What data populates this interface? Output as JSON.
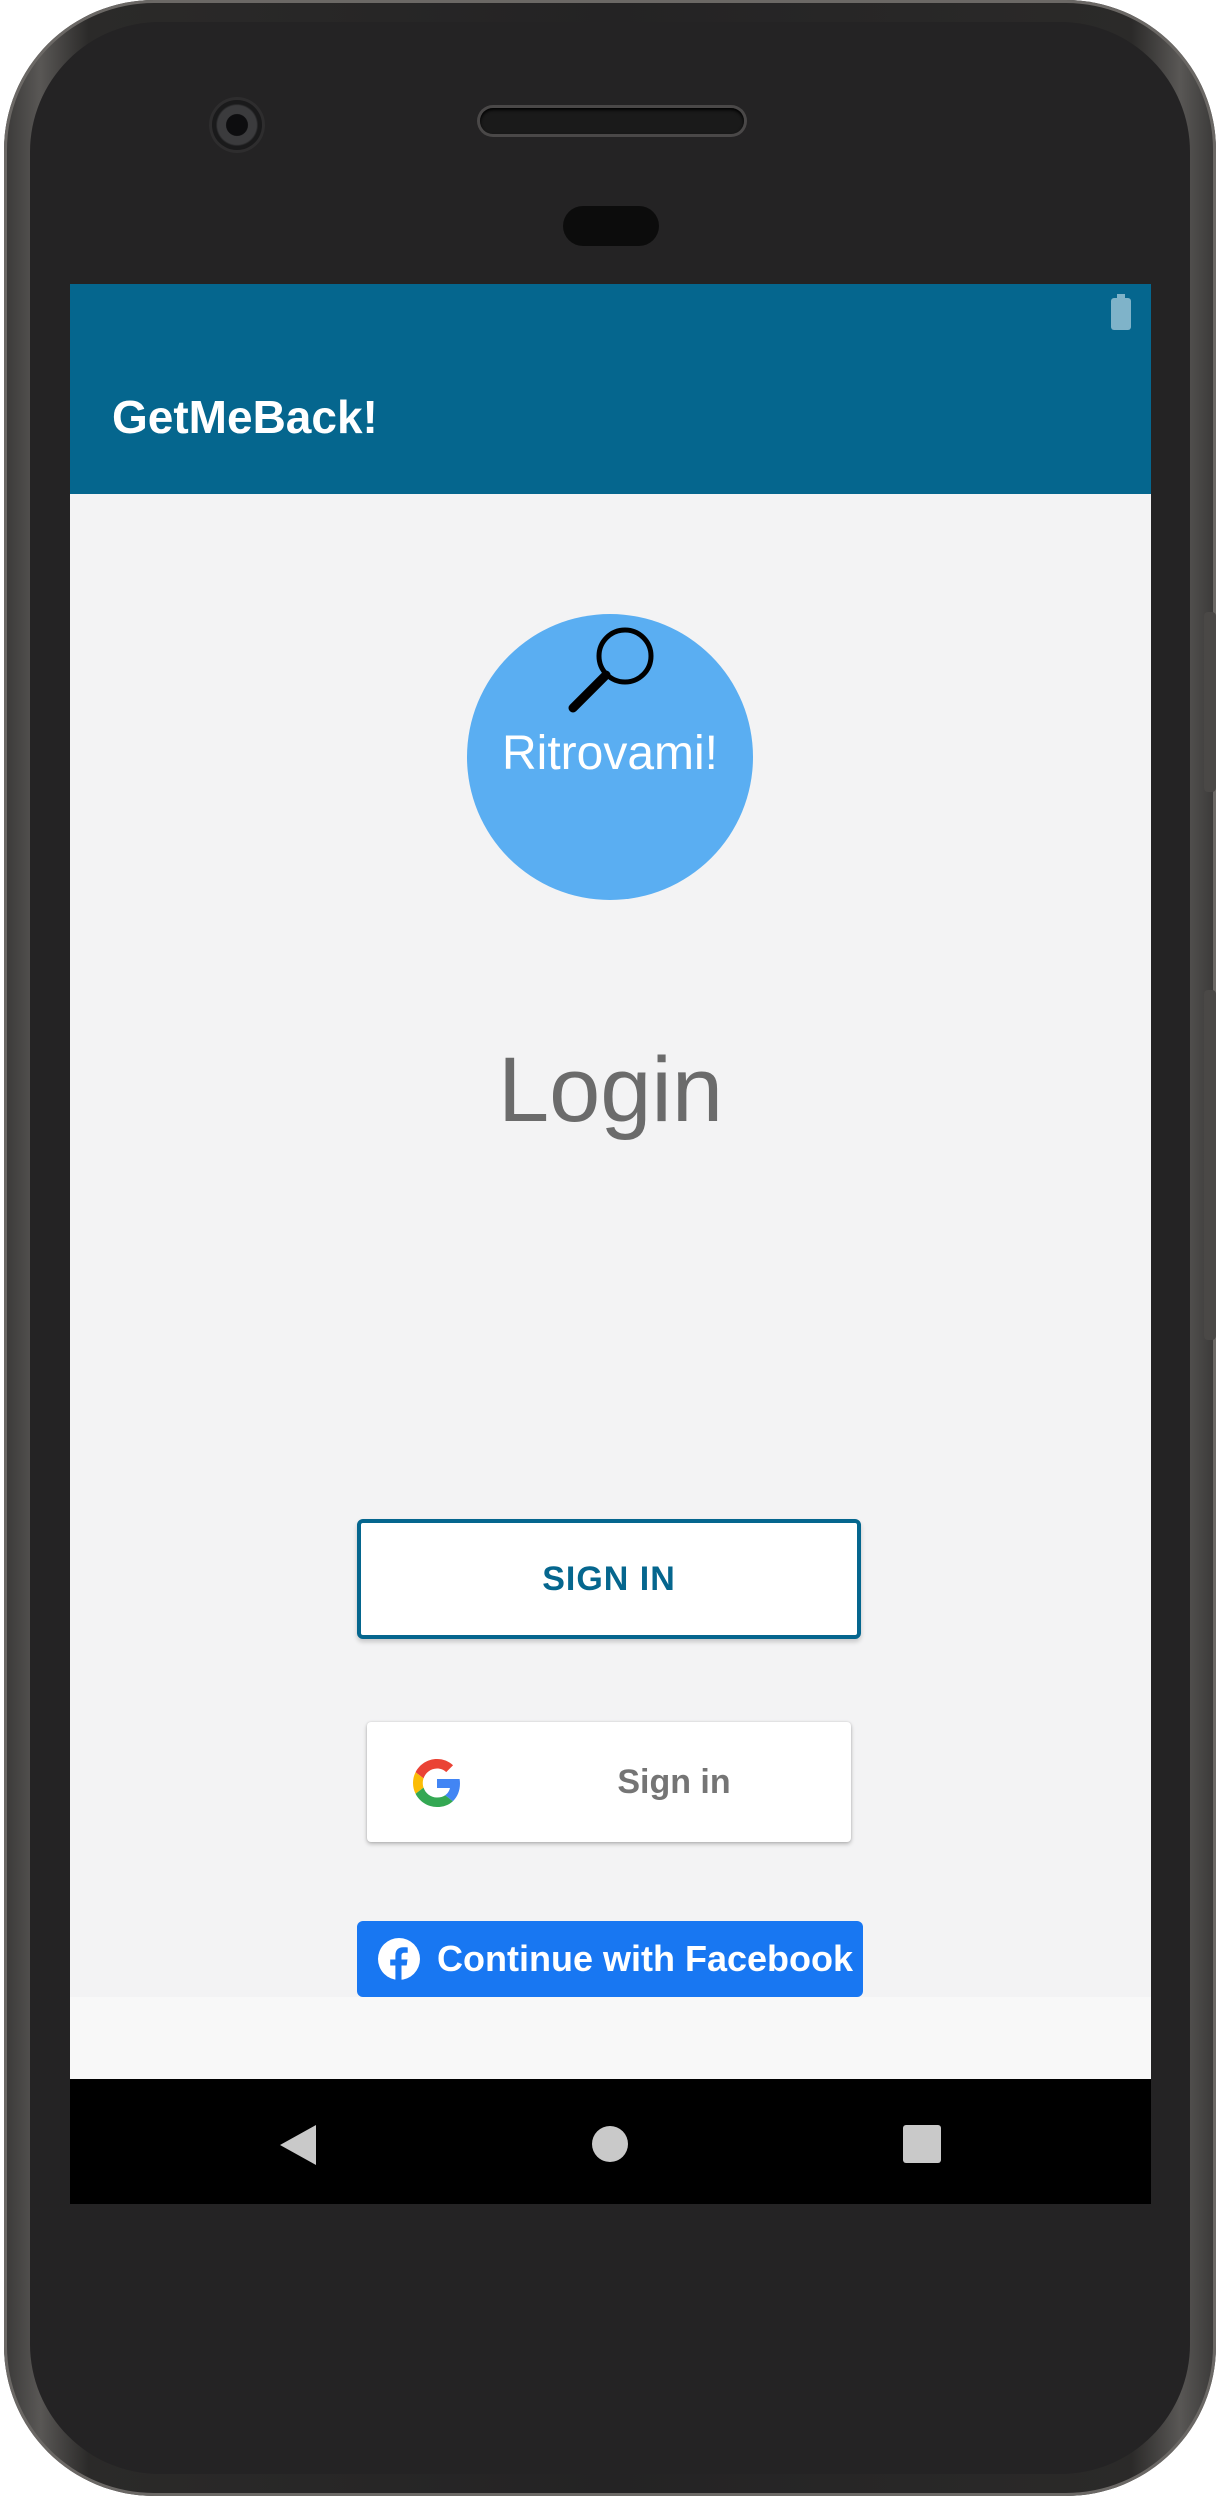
{
  "app": {
    "title": "GetMeBack!"
  },
  "logo": {
    "text": "Ritrovami!",
    "icon": "magnifier-icon"
  },
  "login": {
    "heading": "Login"
  },
  "buttons": {
    "sign_in": "SIGN IN",
    "google_sign_in": "Sign in",
    "facebook": "Continue with Facebook"
  },
  "icons": {
    "google": "google-g-icon",
    "facebook": "facebook-f-icon",
    "battery": "battery-icon",
    "nav_back": "back-triangle-icon",
    "nav_home": "home-circle-icon",
    "nav_recents": "recents-square-icon"
  },
  "colors": {
    "app_bar": "#05668e",
    "primary": "#05668e",
    "logo_circle": "#5aaef2",
    "facebook": "#1877f2",
    "background": "#f3f3f4",
    "nav_bar": "#000000"
  }
}
